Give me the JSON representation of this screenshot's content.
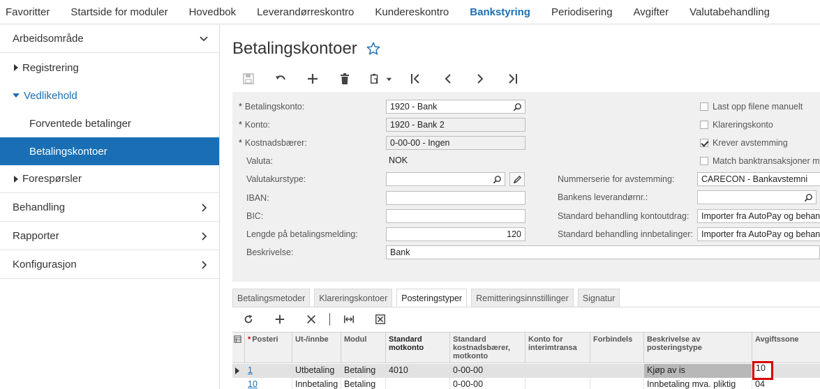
{
  "topnav": {
    "items": [
      {
        "label": "Favoritter",
        "active": false
      },
      {
        "label": "Startside for moduler",
        "active": false
      },
      {
        "label": "Hovedbok",
        "active": false
      },
      {
        "label": "Leverandørreskontro",
        "active": false
      },
      {
        "label": "Kundereskontro",
        "active": false
      },
      {
        "label": "Bankstyring",
        "active": true
      },
      {
        "label": "Periodisering",
        "active": false
      },
      {
        "label": "Avgifter",
        "active": false
      },
      {
        "label": "Valutabehandling",
        "active": false
      }
    ]
  },
  "sidebar": {
    "workspace": "Arbeidsområde",
    "registrering": "Registrering",
    "vedlikehold": "Vedlikehold",
    "forventede": "Forventede betalinger",
    "betalingskontoer": "Betalingskontoer",
    "foresporsler": "Forespørsler",
    "behandling": "Behandling",
    "rapporter": "Rapporter",
    "konfigurasjon": "Konfigurasjon"
  },
  "page": {
    "title": "Betalingskontoer"
  },
  "form": {
    "betalingskonto_label": "Betalingskonto:",
    "betalingskonto_value": "1920 - Bank",
    "konto_label": "Konto:",
    "konto_value": "1920 - Bank 2",
    "kostnadsbaerer_label": "Kostnadsbærer:",
    "kostnadsbaerer_value": "0-00-00 - Ingen",
    "valuta_label": "Valuta:",
    "valuta_value": "NOK",
    "valutakurstype_label": "Valutakurstype:",
    "valutakurstype_value": "",
    "iban_label": "IBAN:",
    "iban_value": "",
    "bic_label": "BIC:",
    "bic_value": "",
    "lengde_label": "Lengde på betalingsmelding:",
    "lengde_value": "120",
    "beskrivelse_label": "Beskrivelse:",
    "beskrivelse_value": "Bank",
    "nummerserie_label": "Nummerserie for avstemming:",
    "nummerserie_value": "CARECON - Bankavstemni",
    "bankens_label": "Bankens leverandørnr.:",
    "bankens_value": "",
    "std_kontoutdrag_label": "Standard behandling kontoutdrag:",
    "std_kontoutdrag_value": "Importer fra AutoPay og behand",
    "std_innbetalinger_label": "Standard behandling innbetalinger:",
    "std_innbetalinger_value": "Importer fra AutoPay og behand",
    "cb_last_opp": "Last opp filene manuelt",
    "cb_klareringskonto": "Klareringskonto",
    "cb_krever": "Krever avstemming",
    "cb_match": "Match banktransaksjoner me"
  },
  "tabs": [
    {
      "label": "Betalingsmetoder",
      "active": false
    },
    {
      "label": "Klareringskontoer",
      "active": false
    },
    {
      "label": "Posteringstyper",
      "active": true
    },
    {
      "label": "Remitteringsinnstillinger",
      "active": false
    },
    {
      "label": "Signatur",
      "active": false
    }
  ],
  "grid": {
    "headers": {
      "posteri": "Posteri",
      "ut_innbe": "Ut-/innbe",
      "modul": "Modul",
      "std_motkonto": "Standard motkonto",
      "std_kostnad": "Standard kostnadsbærer, motkonto",
      "konto_interim": "Konto for interimtransa",
      "forbindels": "Forbindels",
      "beskrivelse": "Beskrivelse av posteringstype",
      "avgiftssone": "Avgiftssone"
    },
    "rows": [
      {
        "posteri": "1",
        "ut_innbe": "Utbetaling",
        "modul": "Betaling",
        "std_motkonto": "4010",
        "std_kostnad": "0-00-00",
        "konto_interim": "",
        "forbindels": "",
        "beskrivelse": "Kjøp av is",
        "avgiftssone": "10"
      },
      {
        "posteri": "10",
        "ut_innbe": "Innbetaling",
        "modul": "Betaling",
        "std_motkonto": "",
        "std_kostnad": "0-00-00",
        "konto_interim": "",
        "forbindels": "",
        "beskrivelse": "Innbetaling mva. pliktig",
        "avgiftssone": "04"
      }
    ]
  },
  "colors": {
    "accent": "#1a6fb4",
    "highlight_box": "#d40000"
  }
}
